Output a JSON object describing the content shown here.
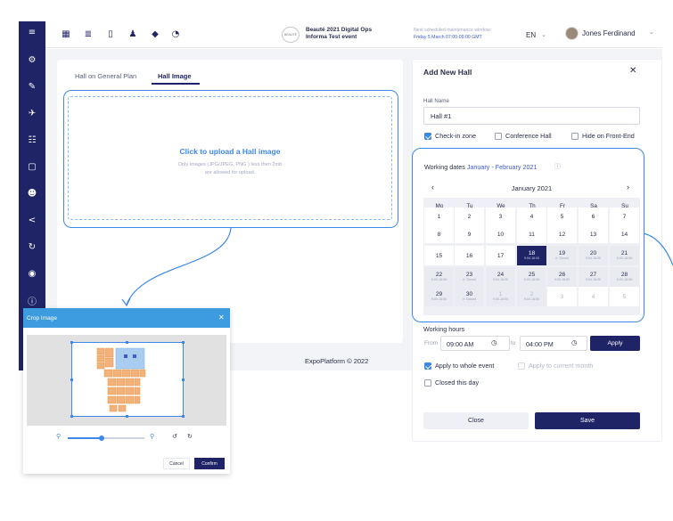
{
  "sidebar": {
    "items": [
      {
        "icon": "menu-icon",
        "glyph": "≡"
      },
      {
        "icon": "gear-icon",
        "glyph": "⚙"
      },
      {
        "icon": "edit-icon",
        "glyph": "✎"
      },
      {
        "icon": "plane-icon",
        "glyph": "✈"
      },
      {
        "icon": "sliders-icon",
        "glyph": "☷"
      },
      {
        "icon": "briefcase-icon",
        "glyph": "▢"
      },
      {
        "icon": "users-icon",
        "glyph": "☻"
      },
      {
        "icon": "share-icon",
        "glyph": "<"
      },
      {
        "icon": "refresh-icon",
        "glyph": "↻"
      },
      {
        "icon": "eye-icon",
        "glyph": "◉"
      },
      {
        "icon": "info-icon",
        "glyph": "ⓘ"
      }
    ]
  },
  "topbar": {
    "icons": [
      {
        "icon": "calendar-icon",
        "glyph": "▦"
      },
      {
        "icon": "database-icon",
        "glyph": "≣"
      },
      {
        "icon": "document-icon",
        "glyph": "▯"
      },
      {
        "icon": "people-icon",
        "glyph": "♟"
      },
      {
        "icon": "tag-icon",
        "glyph": "◆"
      },
      {
        "icon": "speedometer-icon",
        "glyph": "◔"
      }
    ],
    "event_logo_text": "BEAUTÉ",
    "event_name_line1": "Beauté 2021 Digital Ops",
    "event_name_line2": "Informa Test event",
    "maintenance_line1": "Next scheduled maintenance window:",
    "maintenance_line2": "Friday 5 March 07:00-09:00 GMT",
    "language": "EN",
    "user_name": "Jones Ferdinand"
  },
  "hall_card": {
    "tabs": [
      "Hall on General Plan",
      "Hall Image"
    ],
    "upload_title": "Click to upload a Hall image",
    "upload_sub_line1": "Only images (JPG/JPEG, PNG ) less then 2mb",
    "upload_sub_line2": "are allowed for upload."
  },
  "footer": "ExpoPlatform © 2022",
  "modal": {
    "title": "Add New Hall",
    "hall_name_label": "Hall Name",
    "hall_name_value": "Hall #1",
    "checkboxes": [
      {
        "label": "Check-in zone",
        "checked": true
      },
      {
        "label": "Conference Hall",
        "checked": false
      },
      {
        "label": "Hide on Front-End",
        "checked": false
      }
    ],
    "working_dates_label": "Working dates",
    "working_dates_range": "January - February 2021",
    "calendar": {
      "month": "January 2021",
      "prev": "‹",
      "next": "›",
      "weekdays": [
        "Mo",
        "Tu",
        "We",
        "Th",
        "Fr",
        "Sa",
        "Su"
      ],
      "weeks": [
        [
          {
            "d": "1"
          },
          {
            "d": "2"
          },
          {
            "d": "3"
          },
          {
            "d": "4"
          },
          {
            "d": "5"
          },
          {
            "d": "6"
          },
          {
            "d": "7"
          }
        ],
        [
          {
            "d": "8"
          },
          {
            "d": "9"
          },
          {
            "d": "10"
          },
          {
            "d": "11"
          },
          {
            "d": "12"
          },
          {
            "d": "13"
          },
          {
            "d": "14"
          }
        ],
        [
          {
            "d": "15"
          },
          {
            "d": "16"
          },
          {
            "d": "17"
          },
          {
            "d": "18",
            "n": "9:00-16:00",
            "sel": true
          },
          {
            "d": "19",
            "n": "✕ Closed",
            "g": true
          },
          {
            "d": "20",
            "n": "9:00-16:00",
            "g": true
          },
          {
            "d": "21",
            "n": "9:00-16:00",
            "g": true
          }
        ],
        [
          {
            "d": "22",
            "n": "9:00-16:00",
            "g": true
          },
          {
            "d": "23",
            "n": "✕ Closed",
            "g": true
          },
          {
            "d": "24",
            "n": "9:00-16:00",
            "g": true
          },
          {
            "d": "25",
            "n": "9:00-16:00",
            "g": true
          },
          {
            "d": "26",
            "n": "9:00-16:00",
            "g": true
          },
          {
            "d": "27",
            "n": "9:00-16:00",
            "g": true
          },
          {
            "d": "28",
            "n": "9:00-16:00",
            "g": true
          }
        ],
        [
          {
            "d": "29",
            "n": "9:00-16:00",
            "g": true
          },
          {
            "d": "30",
            "n": "✕ Closed",
            "g": true
          },
          {
            "d": "1",
            "n": "9:00-16:00",
            "g": true,
            "m": true
          },
          {
            "d": "2",
            "n": "9:00-16:00",
            "g": true,
            "m": true
          },
          {
            "d": "3",
            "m": true
          },
          {
            "d": "4",
            "m": true
          },
          {
            "d": "5",
            "m": true
          }
        ]
      ]
    },
    "working_hours_label": "Working hours",
    "from_label": "From",
    "from_value": "09:00 AM",
    "to_label": "to",
    "to_value": "04:00 PM",
    "apply_label": "Apply",
    "apply_whole_event": "Apply to whole event",
    "apply_current_month": "Apply to current month",
    "closed_this_day": "Closed this day",
    "close_label": "Close",
    "save_label": "Save"
  },
  "crop": {
    "title": "Crop Image",
    "cancel_label": "Cancel",
    "confirm_label": "Confirm",
    "zoom_level": 0.44
  },
  "colors": {
    "brand_navy": "#1f2467",
    "accent_blue": "#3d88e8",
    "crop_header": "#3d9ce0"
  }
}
